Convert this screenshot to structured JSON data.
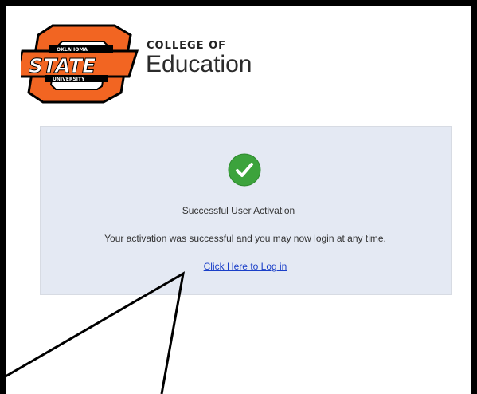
{
  "logo": {
    "name": "oklahoma-state-university-logo",
    "text_top": "OKLAHOMA",
    "text_main": "STATE",
    "text_bottom": "UNIVERSITY",
    "color": "#f26522"
  },
  "header": {
    "college_of": "COLLEGE OF",
    "school_name": "Education"
  },
  "activation": {
    "icon": "check-circle-icon",
    "icon_color": "#3ca33c",
    "title": "Successful User Activation",
    "message": "Your activation was successful and you may now login at any time.",
    "login_link": "Click Here to Log in"
  }
}
